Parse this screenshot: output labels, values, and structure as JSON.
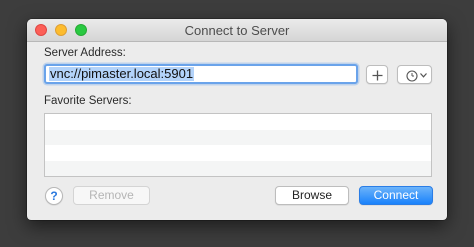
{
  "window": {
    "title": "Connect to Server"
  },
  "form": {
    "server_address_label": "Server Address:",
    "server_address_value": "vnc://pimaster.local:5901",
    "favorites_label": "Favorite Servers:",
    "favorites": []
  },
  "buttons": {
    "add_label": "+",
    "help_label": "?",
    "remove_label": "Remove",
    "browse_label": "Browse",
    "connect_label": "Connect"
  },
  "icons": {
    "add": "plus-icon",
    "recent": "clock-icon",
    "dropdown": "chevron-down-icon"
  },
  "colors": {
    "close": "#fc5f57",
    "minimize": "#fdbc2e",
    "zoom": "#29c941",
    "accent": "#1a82fb",
    "selection": "#b3d3fa"
  }
}
